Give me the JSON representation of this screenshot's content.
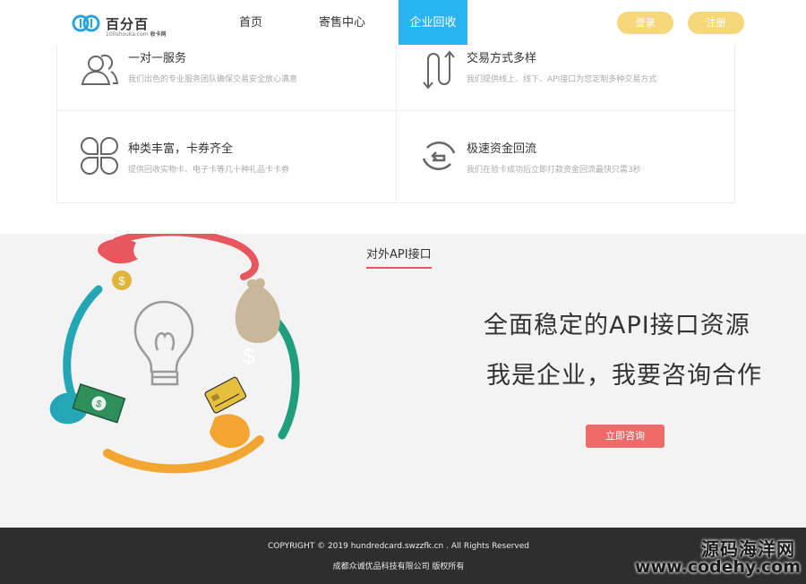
{
  "header": {
    "logo_word": "百分百",
    "logo_sub_left": "100shouka.com",
    "logo_sub_right": "收卡网",
    "nav": [
      "首页",
      "寄售中心",
      "企业回收"
    ],
    "login": "登录",
    "register": "注册",
    "active_color": "#29b3f0",
    "pill_color": "#f6d77a"
  },
  "features": [
    {
      "icon": "users-icon",
      "title": "一对一服务",
      "desc": "我们出色的专业服务团队确保交易安全放心满意"
    },
    {
      "icon": "arrows-updown-icon",
      "title": "交易方式多样",
      "desc": "我们提供线上、线下、API接口为您定制多种交易方式"
    },
    {
      "icon": "clover-icon",
      "title": "种类丰富，卡券齐全",
      "desc": "提供回收实物卡、电子卡等几十种礼品卡卡券"
    },
    {
      "icon": "refresh-icon",
      "title": "极速资金回流",
      "desc": "我们在验卡成功后立即打款资金回流最快只需3秒"
    }
  ],
  "api": {
    "tab": "对外API接口",
    "headline1": "全面稳定的API接口资源",
    "headline2": "我是企业，我要咨询合作",
    "button": "立即咨询",
    "button_color": "#f06a6a",
    "tab_underline": "#e8535c"
  },
  "footer": {
    "copyright": "COPYRIGHT © 2019 hundredcard.swzzfk.cn . All Rights Reserved",
    "company": "成都众诚优品科技有限公司 版权所有"
  },
  "watermark": {
    "line1": "源码海洋网",
    "line2": "www.codehy.com"
  }
}
